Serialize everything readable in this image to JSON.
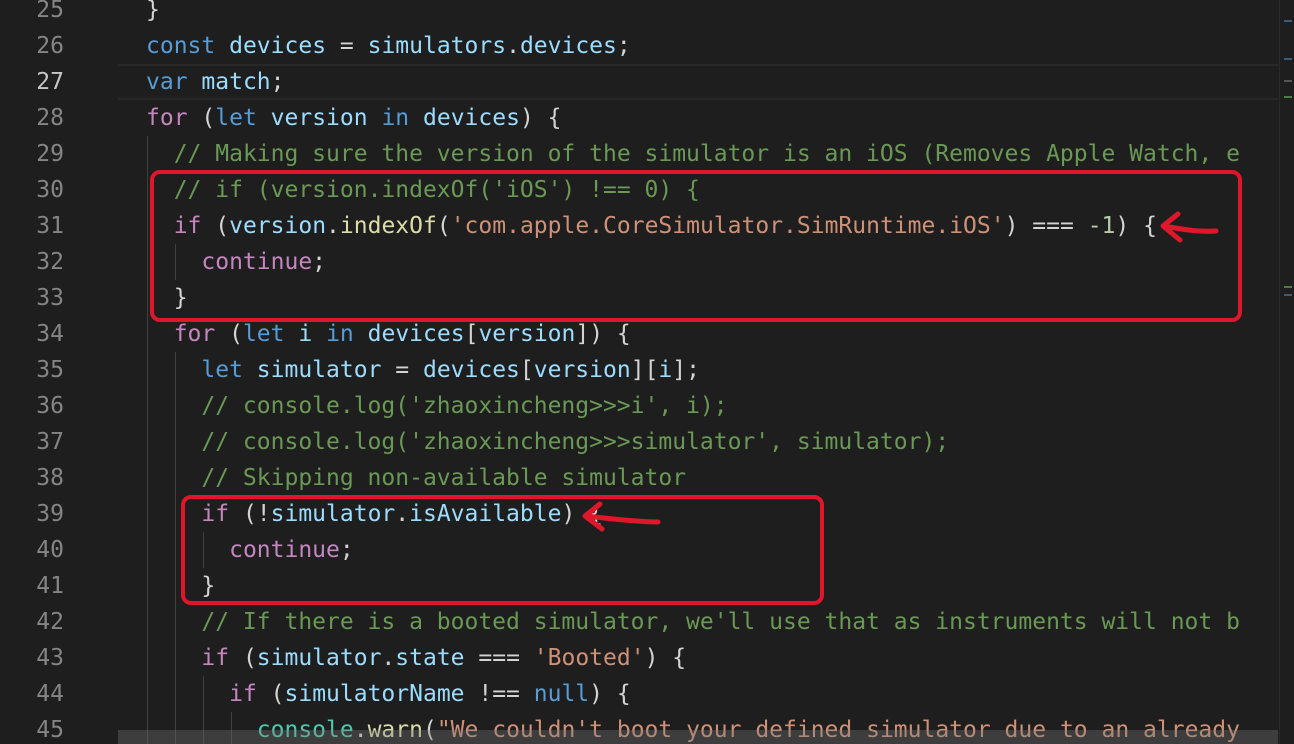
{
  "editor": {
    "active_line": "27",
    "lines": [
      {
        "n": "25",
        "tokens": [
          {
            "t": "}",
            "c": ""
          }
        ]
      },
      {
        "n": "26",
        "tokens": [
          {
            "t": "const",
            "c": "kw"
          },
          {
            "t": " ",
            "c": ""
          },
          {
            "t": "devices",
            "c": "var"
          },
          {
            "t": " = ",
            "c": ""
          },
          {
            "t": "simulators",
            "c": "var"
          },
          {
            "t": ".",
            "c": ""
          },
          {
            "t": "devices",
            "c": "var"
          },
          {
            "t": ";",
            "c": ""
          }
        ]
      },
      {
        "n": "27",
        "tokens": [
          {
            "t": "var",
            "c": "kw"
          },
          {
            "t": " ",
            "c": ""
          },
          {
            "t": "match",
            "c": "var"
          },
          {
            "t": ";",
            "c": ""
          }
        ]
      },
      {
        "n": "28",
        "tokens": [
          {
            "t": "for",
            "c": "ctl"
          },
          {
            "t": " (",
            "c": ""
          },
          {
            "t": "let",
            "c": "kw"
          },
          {
            "t": " ",
            "c": ""
          },
          {
            "t": "version",
            "c": "var"
          },
          {
            "t": " ",
            "c": ""
          },
          {
            "t": "in",
            "c": "kw"
          },
          {
            "t": " ",
            "c": ""
          },
          {
            "t": "devices",
            "c": "var"
          },
          {
            "t": ") {",
            "c": ""
          }
        ]
      },
      {
        "n": "29",
        "tokens": [
          {
            "t": "  ",
            "c": ""
          },
          {
            "t": "// Making sure the version of the simulator is an iOS (Removes Apple Watch, e",
            "c": "cmt"
          }
        ]
      },
      {
        "n": "30",
        "tokens": [
          {
            "t": "  ",
            "c": ""
          },
          {
            "t": "// if (version.indexOf('iOS') !== 0) {",
            "c": "cmt"
          }
        ]
      },
      {
        "n": "31",
        "tokens": [
          {
            "t": "  ",
            "c": ""
          },
          {
            "t": "if",
            "c": "ctl"
          },
          {
            "t": " (",
            "c": ""
          },
          {
            "t": "version",
            "c": "var"
          },
          {
            "t": ".",
            "c": ""
          },
          {
            "t": "indexOf",
            "c": "fn"
          },
          {
            "t": "(",
            "c": ""
          },
          {
            "t": "'com.apple.CoreSimulator.SimRuntime.iOS'",
            "c": "str"
          },
          {
            "t": ") === ",
            "c": ""
          },
          {
            "t": "-1",
            "c": "num"
          },
          {
            "t": ") {",
            "c": ""
          }
        ]
      },
      {
        "n": "32",
        "tokens": [
          {
            "t": "    ",
            "c": ""
          },
          {
            "t": "continue",
            "c": "ctl"
          },
          {
            "t": ";",
            "c": ""
          }
        ]
      },
      {
        "n": "33",
        "tokens": [
          {
            "t": "  }",
            "c": ""
          }
        ]
      },
      {
        "n": "34",
        "tokens": [
          {
            "t": "  ",
            "c": ""
          },
          {
            "t": "for",
            "c": "ctl"
          },
          {
            "t": " (",
            "c": ""
          },
          {
            "t": "let",
            "c": "kw"
          },
          {
            "t": " ",
            "c": ""
          },
          {
            "t": "i",
            "c": "var"
          },
          {
            "t": " ",
            "c": ""
          },
          {
            "t": "in",
            "c": "kw"
          },
          {
            "t": " ",
            "c": ""
          },
          {
            "t": "devices",
            "c": "var"
          },
          {
            "t": "[",
            "c": ""
          },
          {
            "t": "version",
            "c": "var"
          },
          {
            "t": "]) {",
            "c": ""
          }
        ]
      },
      {
        "n": "35",
        "tokens": [
          {
            "t": "    ",
            "c": ""
          },
          {
            "t": "let",
            "c": "kw"
          },
          {
            "t": " ",
            "c": ""
          },
          {
            "t": "simulator",
            "c": "var"
          },
          {
            "t": " = ",
            "c": ""
          },
          {
            "t": "devices",
            "c": "var"
          },
          {
            "t": "[",
            "c": ""
          },
          {
            "t": "version",
            "c": "var"
          },
          {
            "t": "][",
            "c": ""
          },
          {
            "t": "i",
            "c": "var"
          },
          {
            "t": "];",
            "c": ""
          }
        ]
      },
      {
        "n": "36",
        "tokens": [
          {
            "t": "    ",
            "c": ""
          },
          {
            "t": "// console.log('zhaoxincheng>>>i', i);",
            "c": "cmt"
          }
        ]
      },
      {
        "n": "37",
        "tokens": [
          {
            "t": "    ",
            "c": ""
          },
          {
            "t": "// console.log('zhaoxincheng>>>simulator', simulator);",
            "c": "cmt"
          }
        ]
      },
      {
        "n": "38",
        "tokens": [
          {
            "t": "    ",
            "c": ""
          },
          {
            "t": "// Skipping non-available simulator",
            "c": "cmt"
          }
        ]
      },
      {
        "n": "39",
        "tokens": [
          {
            "t": "    ",
            "c": ""
          },
          {
            "t": "if",
            "c": "ctl"
          },
          {
            "t": " (!",
            "c": ""
          },
          {
            "t": "simulator",
            "c": "var"
          },
          {
            "t": ".",
            "c": ""
          },
          {
            "t": "isAvailable",
            "c": "var"
          },
          {
            "t": ") {",
            "c": ""
          }
        ]
      },
      {
        "n": "40",
        "tokens": [
          {
            "t": "      ",
            "c": ""
          },
          {
            "t": "continue",
            "c": "ctl"
          },
          {
            "t": ";",
            "c": ""
          }
        ]
      },
      {
        "n": "41",
        "tokens": [
          {
            "t": "    }",
            "c": ""
          }
        ]
      },
      {
        "n": "42",
        "tokens": [
          {
            "t": "    ",
            "c": ""
          },
          {
            "t": "// If there is a booted simulator, we'll use that as instruments will not b",
            "c": "cmt"
          }
        ]
      },
      {
        "n": "43",
        "tokens": [
          {
            "t": "    ",
            "c": ""
          },
          {
            "t": "if",
            "c": "ctl"
          },
          {
            "t": " (",
            "c": ""
          },
          {
            "t": "simulator",
            "c": "var"
          },
          {
            "t": ".",
            "c": ""
          },
          {
            "t": "state",
            "c": "var"
          },
          {
            "t": " === ",
            "c": ""
          },
          {
            "t": "'Booted'",
            "c": "str"
          },
          {
            "t": ") {",
            "c": ""
          }
        ]
      },
      {
        "n": "44",
        "tokens": [
          {
            "t": "      ",
            "c": ""
          },
          {
            "t": "if",
            "c": "ctl"
          },
          {
            "t": " (",
            "c": ""
          },
          {
            "t": "simulatorName",
            "c": "var"
          },
          {
            "t": " !== ",
            "c": ""
          },
          {
            "t": "null",
            "c": "kw"
          },
          {
            "t": ") {",
            "c": ""
          }
        ]
      },
      {
        "n": "45",
        "tokens": [
          {
            "t": "        ",
            "c": ""
          },
          {
            "t": "console",
            "c": "cls"
          },
          {
            "t": ".",
            "c": ""
          },
          {
            "t": "warn",
            "c": "fn"
          },
          {
            "t": "(",
            "c": ""
          },
          {
            "t": "\"We couldn't boot your defined simulator due to an already",
            "c": "str"
          }
        ]
      }
    ]
  },
  "annotations": {
    "color": "#e0162b"
  },
  "theme": {
    "background": "#1e1e1e",
    "line_number": "#858585",
    "keyword": "#569cd6",
    "control": "#c586c0",
    "variable": "#9cdcfe",
    "function": "#dcdcaa",
    "string": "#ce9178",
    "comment": "#6a9955"
  }
}
